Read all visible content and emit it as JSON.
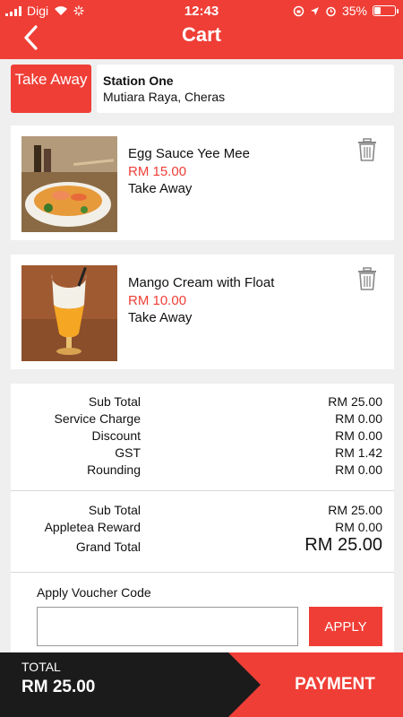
{
  "status_bar": {
    "carrier": "Digi",
    "time": "12:43",
    "battery": "35%",
    "battery_level": 0.35,
    "icons": [
      "signal-icon",
      "wifi-icon",
      "loading-icon",
      "rotation-lock-icon",
      "location-icon",
      "alarm-icon",
      "battery-icon"
    ]
  },
  "header": {
    "title": "Cart",
    "back_icon": "chevron-left-icon"
  },
  "store": {
    "mode_label": "Take Away",
    "name": "Station One",
    "address": "Mutiara Raya, Cheras"
  },
  "items": [
    {
      "name": "Egg Sauce Yee Mee",
      "price": "RM 15.00",
      "mode": "Take Away",
      "delete_icon": "trash-icon"
    },
    {
      "name": "Mango Cream with Float",
      "price": "RM 10.00",
      "mode": "Take Away",
      "delete_icon": "trash-icon"
    }
  ],
  "summary": {
    "charges": [
      {
        "label": "Sub Total",
        "value": "RM 25.00"
      },
      {
        "label": "Service Charge",
        "value": "RM 0.00"
      },
      {
        "label": "Discount",
        "value": "RM 0.00"
      },
      {
        "label": "GST",
        "value": "RM 1.42"
      },
      {
        "label": "Rounding",
        "value": "RM 0.00"
      }
    ],
    "totals": [
      {
        "label": "Sub Total",
        "value": "RM 25.00"
      },
      {
        "label": "Appletea Reward",
        "value": "RM 0.00"
      },
      {
        "label": "Grand Total",
        "value": "RM 25.00"
      }
    ]
  },
  "voucher": {
    "label": "Apply Voucher Code",
    "value": "",
    "placeholder": "",
    "apply_label": "APPLY"
  },
  "footer": {
    "total_label": "TOTAL",
    "total_value": "RM 25.00",
    "payment_label": "PAYMENT"
  },
  "colors": {
    "accent": "#ef3e36",
    "footer_bg": "#1b1b1b",
    "page_bg": "#efefef"
  }
}
